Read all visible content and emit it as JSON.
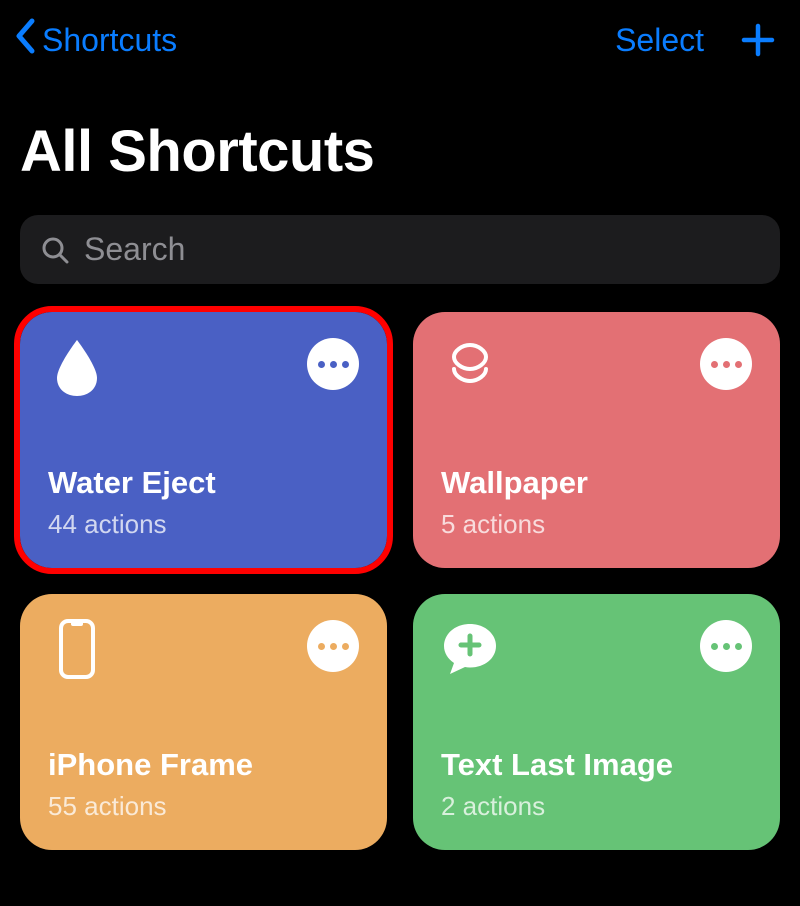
{
  "nav": {
    "back_label": "Shortcuts",
    "select_label": "Select"
  },
  "page": {
    "title": "All Shortcuts"
  },
  "search": {
    "placeholder": "Search"
  },
  "tiles": [
    {
      "title": "Water Eject",
      "subtitle": "44 actions",
      "color": "blue",
      "icon": "water-drop",
      "highlighted": true
    },
    {
      "title": "Wallpaper",
      "subtitle": "5 actions",
      "color": "red",
      "icon": "layers",
      "highlighted": false
    },
    {
      "title": "iPhone Frame",
      "subtitle": "55 actions",
      "color": "orange",
      "icon": "phone",
      "highlighted": false
    },
    {
      "title": "Text Last Image",
      "subtitle": "2 actions",
      "color": "green",
      "icon": "speech-plus",
      "highlighted": false
    }
  ]
}
